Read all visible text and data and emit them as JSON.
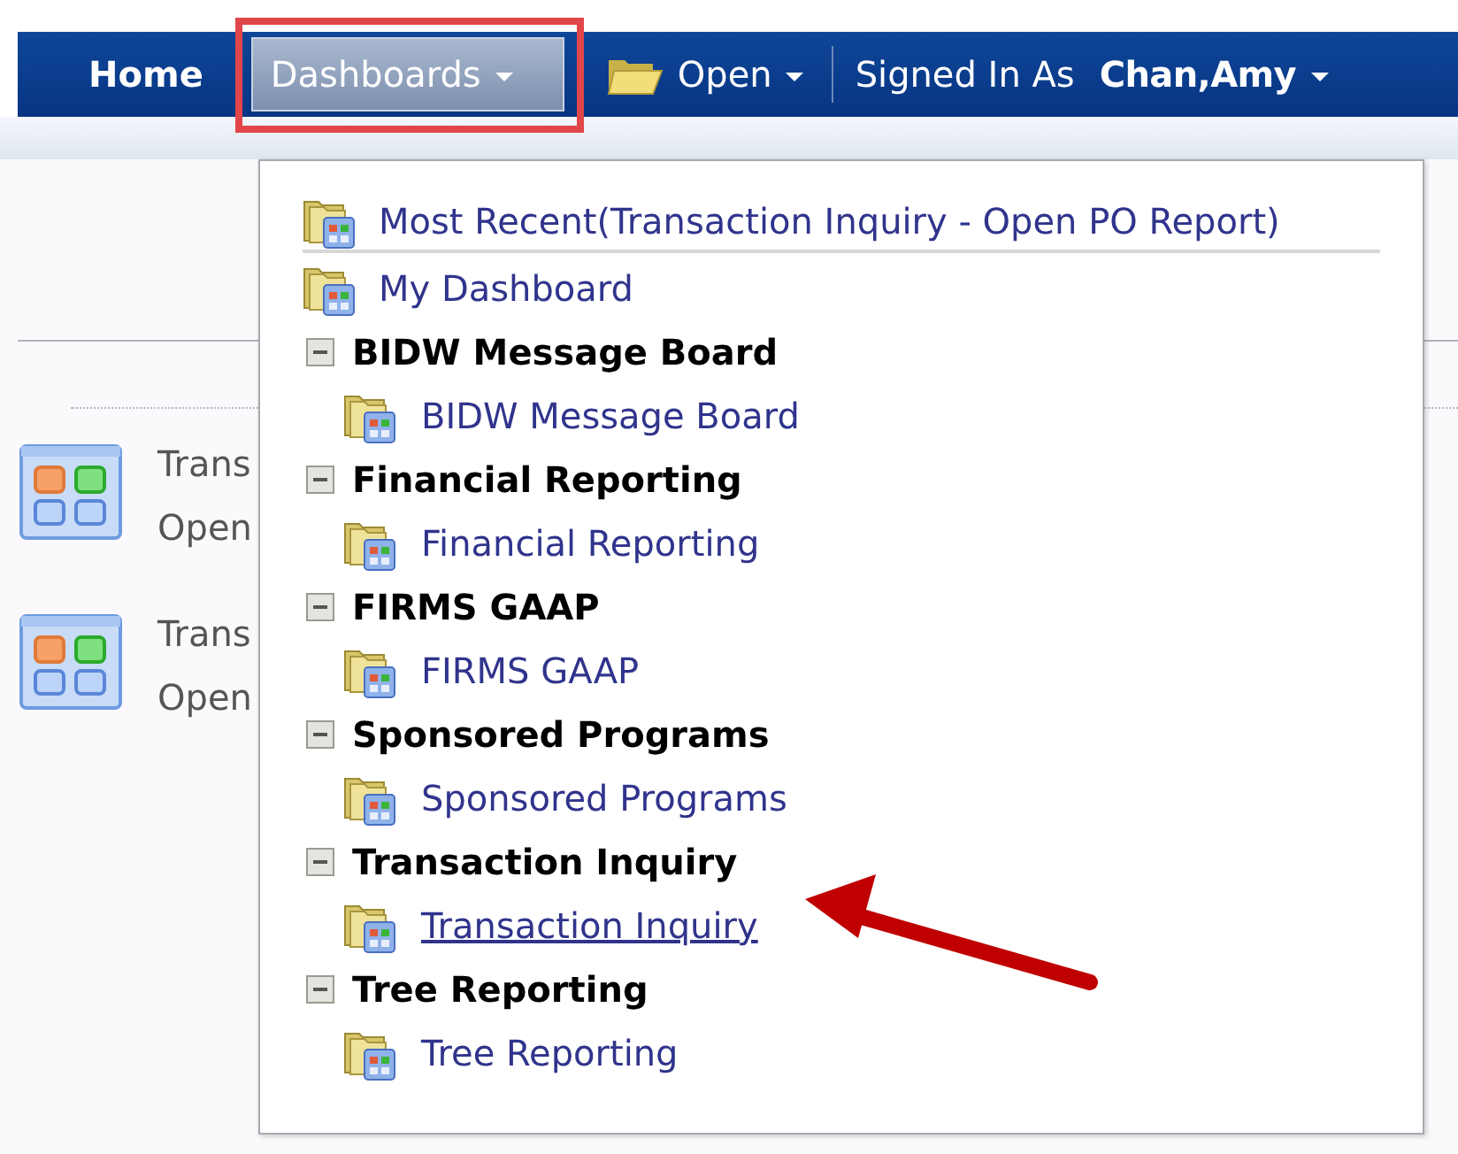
{
  "nav": {
    "items": [
      {
        "kind": "link",
        "label": "Home",
        "selected": false
      },
      {
        "kind": "menu",
        "label": "Dashboards",
        "selected": true
      },
      {
        "kind": "folder-menu",
        "label": "Open",
        "selected": false
      }
    ],
    "signed_in_label": "Signed In As",
    "user": "Chan,Amy"
  },
  "background": {
    "tiles": [
      {
        "title": "Trans",
        "subtitle": "Open"
      },
      {
        "title": "Trans",
        "subtitle": "Open"
      }
    ]
  },
  "menu": {
    "most_recent": "Most Recent(Transaction Inquiry - Open PO Report)",
    "my_dashboard": "My Dashboard",
    "groups": [
      {
        "title": "BIDW Message Board",
        "expanded": true,
        "items": [
          {
            "label": "BIDW Message Board",
            "hovered": false
          }
        ]
      },
      {
        "title": "Financial Reporting",
        "expanded": true,
        "items": [
          {
            "label": "Financial Reporting",
            "hovered": false
          }
        ]
      },
      {
        "title": "FIRMS GAAP",
        "expanded": true,
        "items": [
          {
            "label": "FIRMS GAAP",
            "hovered": false
          }
        ]
      },
      {
        "title": "Sponsored Programs",
        "expanded": true,
        "items": [
          {
            "label": "Sponsored Programs",
            "hovered": false
          }
        ]
      },
      {
        "title": "Transaction Inquiry",
        "expanded": true,
        "items": [
          {
            "label": "Transaction Inquiry",
            "hovered": true
          }
        ]
      },
      {
        "title": "Tree Reporting",
        "expanded": true,
        "items": [
          {
            "label": "Tree Reporting",
            "hovered": false
          }
        ]
      }
    ]
  }
}
